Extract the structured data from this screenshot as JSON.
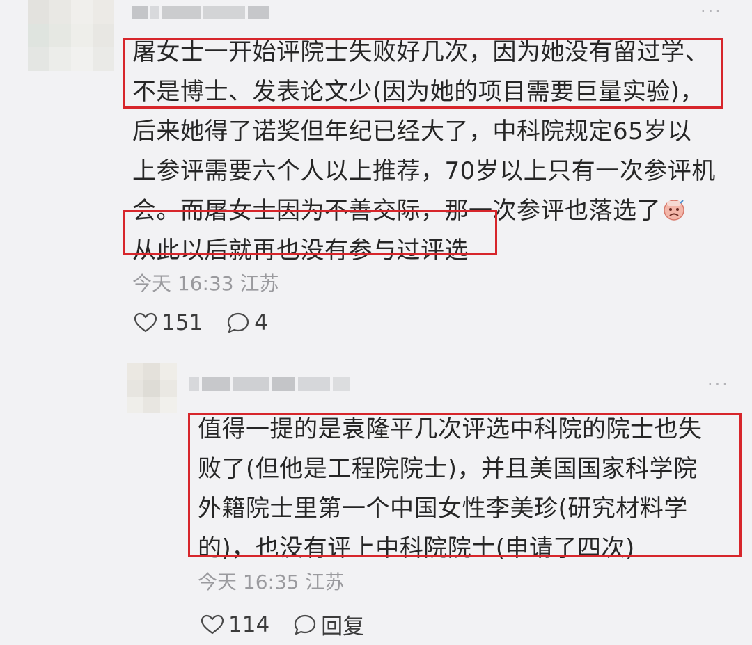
{
  "colors": {
    "highlight_box": "#d7262b",
    "background": "#f2f2f4",
    "meta_text": "#9a9a9e"
  },
  "comment": {
    "lines": [
      "屠女士一开始评院士失败好几次，因为她没有留过学、",
      "不是博士、发表论文少(因为她的项目需要巨量实验)，",
      "后来她得了诺奖但年纪已经大了，中科院规定65岁以",
      "上参评需要六个人以上推荐，70岁以上只有一次参评机",
      "会。而屠女士因为不善交际，那一次参评也落选了",
      "从此以后就再也没有参与过评选"
    ],
    "emoji": "sad-emoji",
    "meta": "今天 16:33 江苏",
    "likes": "151",
    "replies": "4",
    "icons": [
      "heart-icon",
      "comment-bubble-icon",
      "more-dots-icon"
    ]
  },
  "reply": {
    "lines": [
      "值得一提的是袁隆平几次评选中科院的院士也失",
      "败了(但他是工程院院士)，并且美国国家科学院",
      "外籍院士里第一个中国女性李美珍(研究材料学",
      "的)，也没有评上中科院院士(申请了四次)"
    ],
    "meta": "今天 16:35 江苏",
    "likes": "114",
    "reply_label": "回复",
    "icons": [
      "heart-icon",
      "comment-bubble-icon",
      "more-dots-icon"
    ]
  }
}
